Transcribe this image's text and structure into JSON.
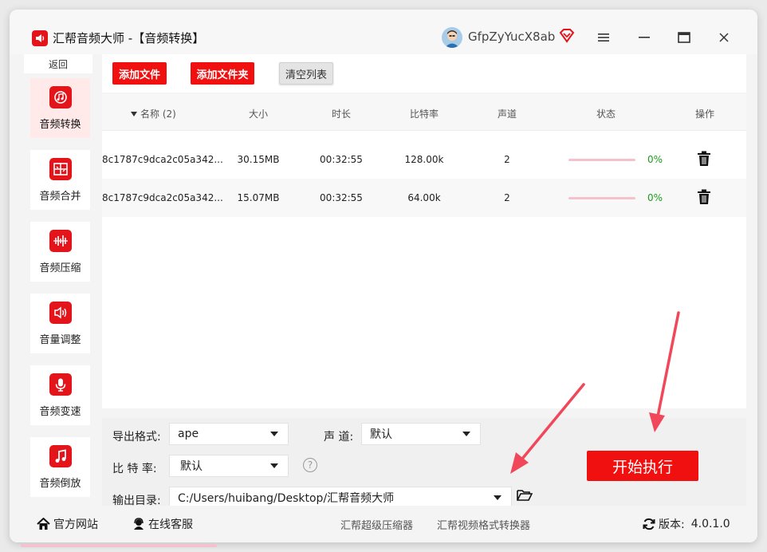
{
  "window": {
    "app_name": "汇帮音频大师",
    "title_suffix": " -【音频转换】",
    "username": "GfpZyYucX8ab"
  },
  "sidebar": {
    "back_label": "返回",
    "items": [
      {
        "label": "音频转换",
        "icon": "audio-convert-icon",
        "active": true
      },
      {
        "label": "音频合并",
        "icon": "audio-merge-icon",
        "active": false
      },
      {
        "label": "音频压缩",
        "icon": "audio-compress-icon",
        "active": false
      },
      {
        "label": "音量调整",
        "icon": "volume-icon",
        "active": false
      },
      {
        "label": "音频变速",
        "icon": "microphone-icon",
        "active": false
      },
      {
        "label": "音频倒放",
        "icon": "music-note-icon",
        "active": false
      }
    ]
  },
  "toolbar": {
    "add_file": "添加文件",
    "add_folder": "添加文件夹",
    "clear_list": "清空列表"
  },
  "table": {
    "headers": {
      "name": "名称 (2)",
      "size": "大小",
      "duration": "时长",
      "bitrate": "比特率",
      "channels": "声道",
      "status": "状态",
      "action": "操作"
    },
    "rows": [
      {
        "name": "8c1787c9dca2c05a342...",
        "size": "30.15MB",
        "duration": "00:32:55",
        "bitrate": "128.00k",
        "channels": "2",
        "progress_pct": "0%"
      },
      {
        "name": "8c1787c9dca2c05a342...",
        "size": "15.07MB",
        "duration": "00:32:55",
        "bitrate": "64.00k",
        "channels": "2",
        "progress_pct": "0%"
      }
    ]
  },
  "settings": {
    "format_label": "导出格式:",
    "format_value": "ape",
    "channel_label": "声 道:",
    "channel_value": "默认",
    "bitrate_label": "比 特 率:",
    "bitrate_value": "默认",
    "help_glyph": "?",
    "output_label": "输出目录:",
    "output_value": "C:/Users/huibang/Desktop/汇帮音频大师",
    "start_button": "开始执行"
  },
  "footer": {
    "website": "官方网站",
    "support": "在线客服",
    "link_compressor": "汇帮超级压缩器",
    "link_video": "汇帮视频格式转换器",
    "version_label": "版本:",
    "version_value": "4.0.1.0"
  },
  "colors": {
    "accent_red": "#f01010",
    "progress_track": "#f3c2cc",
    "percent_green": "#1a9d1a",
    "annotation_red": "#f0485a"
  }
}
